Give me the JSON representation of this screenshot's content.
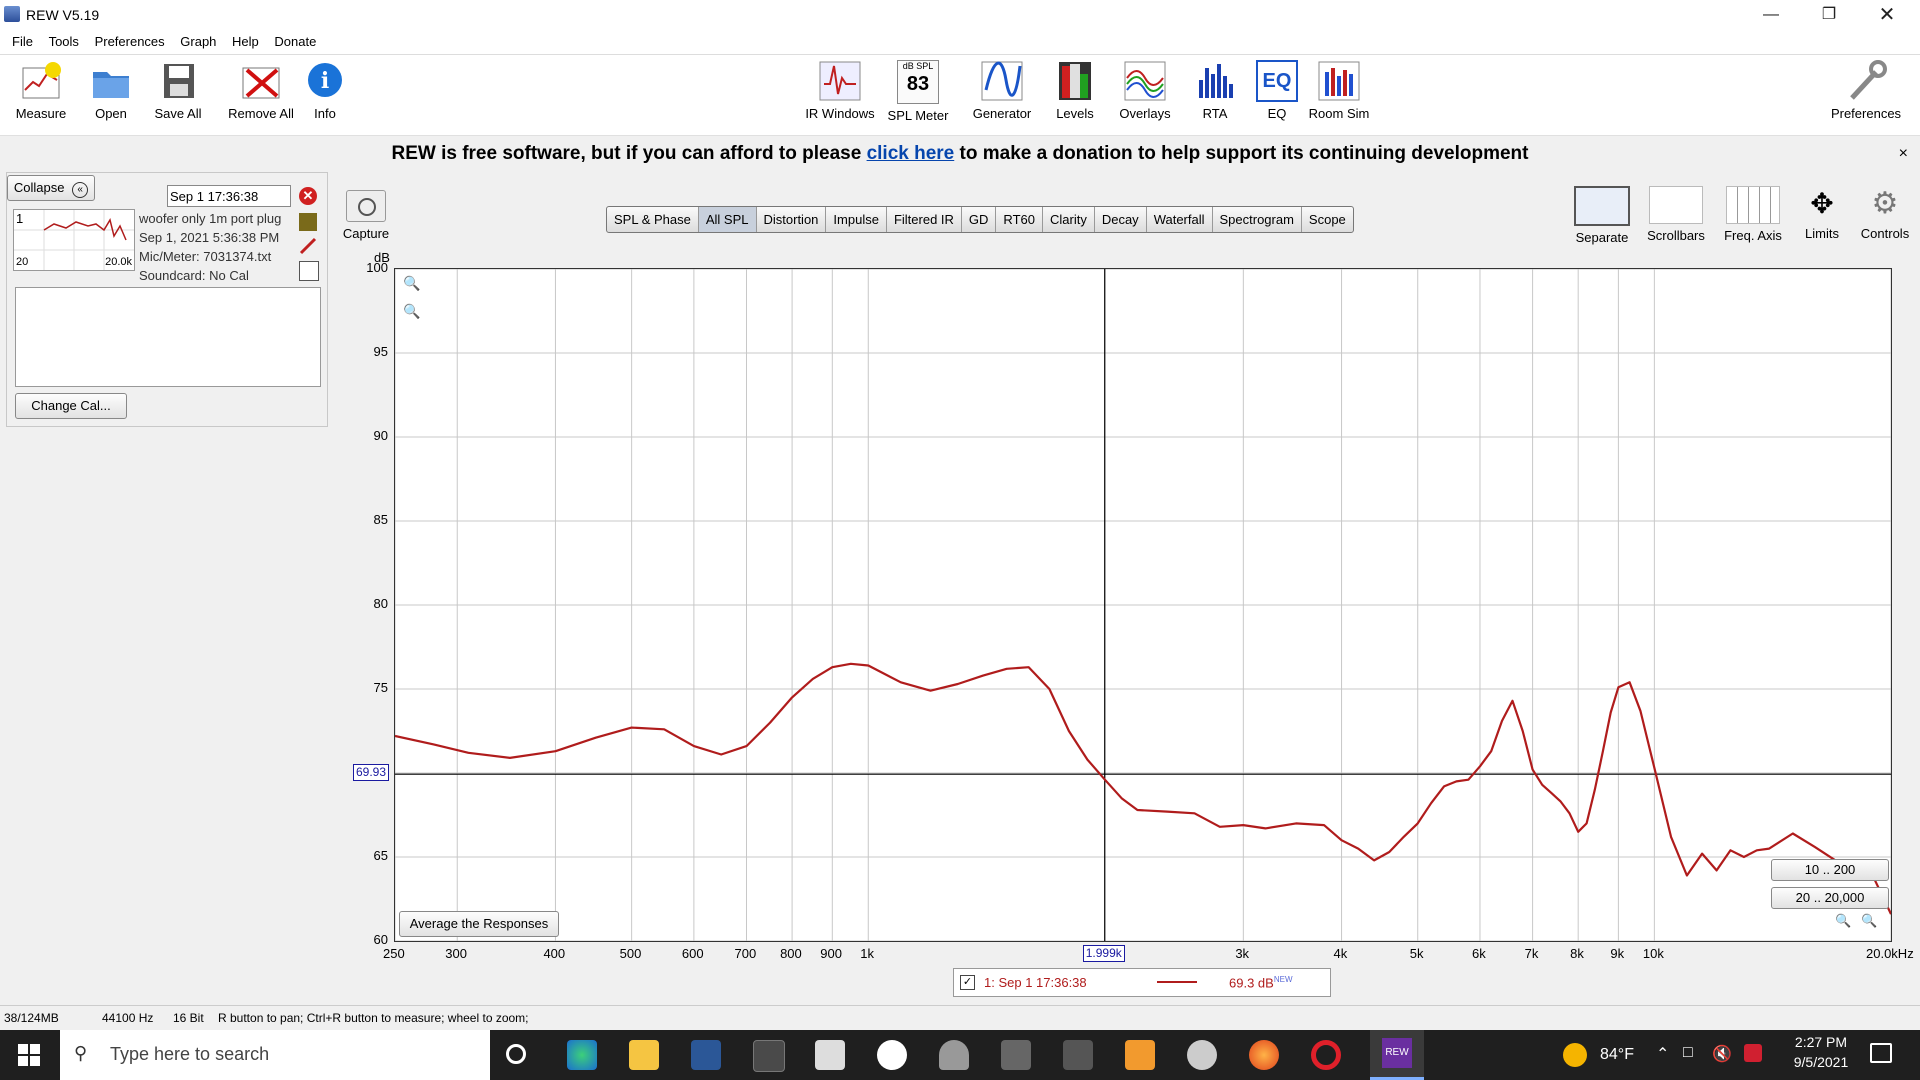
{
  "window": {
    "title": "REW V5.19"
  },
  "menu": [
    "File",
    "Tools",
    "Preferences",
    "Graph",
    "Help",
    "Donate"
  ],
  "toolbar_left": [
    {
      "label": "Measure",
      "icon": "measure-icon"
    },
    {
      "label": "Open",
      "icon": "folder-icon"
    },
    {
      "label": "Save All",
      "icon": "save-icon"
    },
    {
      "label": "Remove All",
      "icon": "remove-icon"
    },
    {
      "label": "Info",
      "icon": "info-icon"
    }
  ],
  "toolbar_center": [
    {
      "label": "IR Windows",
      "icon": "ir-windows-icon"
    },
    {
      "label": "SPL Meter",
      "icon": "spl-meter-icon",
      "top": "dB SPL",
      "value": "83"
    },
    {
      "label": "Generator",
      "icon": "generator-icon"
    },
    {
      "label": "Levels",
      "icon": "levels-icon"
    },
    {
      "label": "Overlays",
      "icon": "overlays-icon"
    },
    {
      "label": "RTA",
      "icon": "rta-icon"
    },
    {
      "label": "EQ",
      "icon": "eq-icon",
      "text": "EQ"
    },
    {
      "label": "Room Sim",
      "icon": "room-sim-icon"
    }
  ],
  "preferences_label": "Preferences",
  "banner": {
    "pre": "REW is free software, but if you can afford to please",
    "link": "click here",
    "post": "to make a donation to help support its continuing development",
    "close": "×"
  },
  "panel": {
    "collapse_label": "Collapse",
    "measurement": {
      "index": "1",
      "name": "Sep 1 17:36:38",
      "line1": "woofer only 1m port plug",
      "line2": "Sep 1, 2021 5:36:38 PM",
      "line3": "Mic/Meter: 7031374.txt",
      "line4": "Soundcard: No Cal",
      "thumb_left": "20",
      "thumb_right": "20.0k"
    },
    "change_cal_label": "Change Cal..."
  },
  "capture_label": "Capture",
  "tabs": [
    "SPL & Phase",
    "All SPL",
    "Distortion",
    "Impulse",
    "Filtered IR",
    "GD",
    "RT60",
    "Clarity",
    "Decay",
    "Waterfall",
    "Spectrogram",
    "Scope"
  ],
  "selected_tab": "All SPL",
  "controls": [
    "Separate",
    "Scrollbars",
    "Freq. Axis",
    "Limits",
    "Controls"
  ],
  "graph": {
    "y_unit": "dB",
    "cursor_y_label": "69.93",
    "cursor_x_label": "1.999k",
    "average_button": "Average the Responses",
    "range_buttons": [
      "10 .. 200",
      "20 .. 20,000"
    ]
  },
  "legend": {
    "name": "1: Sep 1 17:36:38",
    "value": "69.3 dB",
    "sup": "NEW"
  },
  "status": {
    "memory": "38/124MB",
    "rate": "44100 Hz",
    "bits": "16 Bit",
    "hint": "R button to pan; Ctrl+R button to measure; wheel to zoom;"
  },
  "taskbar": {
    "search_placeholder": "Type here to search",
    "temp": "84°F",
    "time": "2:27 PM",
    "date": "9/5/2021"
  },
  "colors": {
    "trace": "#b01c1c",
    "cursor_label": "#1a1aa0",
    "link": "#0645ad"
  },
  "chart_data": {
    "type": "line",
    "xlabel": "",
    "ylabel": "dB",
    "xscale": "log",
    "xlim": [
      250,
      20000
    ],
    "ylim": [
      60,
      100
    ],
    "y_ticks": [
      60,
      65,
      70,
      75,
      80,
      85,
      90,
      95,
      100
    ],
    "x_ticks": [
      {
        "v": 250,
        "l": "250"
      },
      {
        "v": 300,
        "l": "300"
      },
      {
        "v": 400,
        "l": "400"
      },
      {
        "v": 500,
        "l": "500"
      },
      {
        "v": 600,
        "l": "600"
      },
      {
        "v": 700,
        "l": "700"
      },
      {
        "v": 800,
        "l": "800"
      },
      {
        "v": 900,
        "l": "900"
      },
      {
        "v": 1000,
        "l": "1k"
      },
      {
        "v": 3000,
        "l": "3k"
      },
      {
        "v": 4000,
        "l": "4k"
      },
      {
        "v": 5000,
        "l": "5k"
      },
      {
        "v": 6000,
        "l": "6k"
      },
      {
        "v": 7000,
        "l": "7k"
      },
      {
        "v": 8000,
        "l": "8k"
      },
      {
        "v": 9000,
        "l": "9k"
      },
      {
        "v": 10000,
        "l": "10k"
      },
      {
        "v": 20000,
        "l": "20.0kHz"
      }
    ],
    "x_grid": [
      250,
      300,
      400,
      500,
      600,
      700,
      800,
      900,
      1000,
      2000,
      3000,
      4000,
      5000,
      6000,
      7000,
      8000,
      9000,
      10000,
      20000
    ],
    "cursor": {
      "x": 1999,
      "y": 69.93
    },
    "grid": true,
    "series": [
      {
        "name": "1: Sep 1 17:36:38",
        "x": [
          250,
          280,
          310,
          350,
          400,
          450,
          500,
          550,
          600,
          650,
          700,
          750,
          800,
          850,
          900,
          950,
          1000,
          1100,
          1200,
          1300,
          1400,
          1500,
          1600,
          1700,
          1800,
          1900,
          2000,
          2100,
          2200,
          2400,
          2600,
          2800,
          3000,
          3200,
          3500,
          3800,
          4000,
          4200,
          4400,
          4600,
          4800,
          5000,
          5200,
          5400,
          5600,
          5800,
          6000,
          6200,
          6400,
          6600,
          6800,
          7000,
          7200,
          7400,
          7600,
          7800,
          8000,
          8200,
          8400,
          8600,
          8800,
          9000,
          9300,
          9600,
          10000,
          10500,
          11000,
          11500,
          12000,
          12500,
          13000,
          13500,
          14000,
          15000,
          16000,
          17000,
          18000,
          19000,
          20000
        ],
        "y": [
          72.2,
          71.7,
          71.2,
          70.9,
          71.3,
          72.1,
          72.7,
          72.6,
          71.6,
          71.1,
          71.6,
          73.0,
          74.5,
          75.6,
          76.3,
          76.5,
          76.4,
          75.4,
          74.9,
          75.3,
          75.8,
          76.2,
          76.3,
          75.0,
          72.5,
          70.8,
          69.6,
          68.5,
          67.8,
          67.7,
          67.6,
          66.8,
          66.9,
          66.7,
          67.0,
          66.9,
          66.0,
          65.5,
          64.8,
          65.3,
          66.2,
          67.0,
          68.2,
          69.2,
          69.5,
          69.6,
          70.4,
          71.3,
          73.1,
          74.3,
          72.5,
          70.2,
          69.3,
          68.8,
          68.3,
          67.6,
          66.5,
          67.0,
          69.0,
          71.3,
          73.6,
          75.1,
          75.4,
          73.7,
          70.3,
          66.2,
          63.9,
          65.2,
          64.2,
          65.4,
          65.0,
          65.4,
          65.5,
          66.4,
          65.6,
          64.8,
          64.1,
          63.8,
          61.6
        ]
      }
    ]
  }
}
